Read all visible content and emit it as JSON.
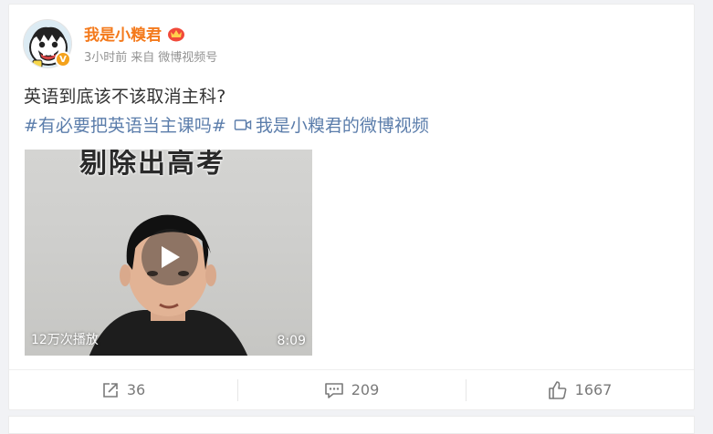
{
  "post": {
    "username": "我是小糗君",
    "timestamp": "3小时前",
    "via_label": "来自",
    "source": "微博视频号",
    "text": "英语到底该不该取消主科?",
    "hashtag": "#有必要把英语当主课吗#",
    "video_link_text": "我是小糗君的微博视频",
    "vip_badge_text": "V"
  },
  "video": {
    "caption": "剔除出高考",
    "views": "12万次播放",
    "duration": "8:09"
  },
  "actions": {
    "share_count": "36",
    "comment_count": "209",
    "like_count": "1667"
  },
  "colors": {
    "username": "#f47a1c",
    "link": "#5b7dab",
    "meta": "#939393",
    "action_text": "#7a7a7a"
  }
}
